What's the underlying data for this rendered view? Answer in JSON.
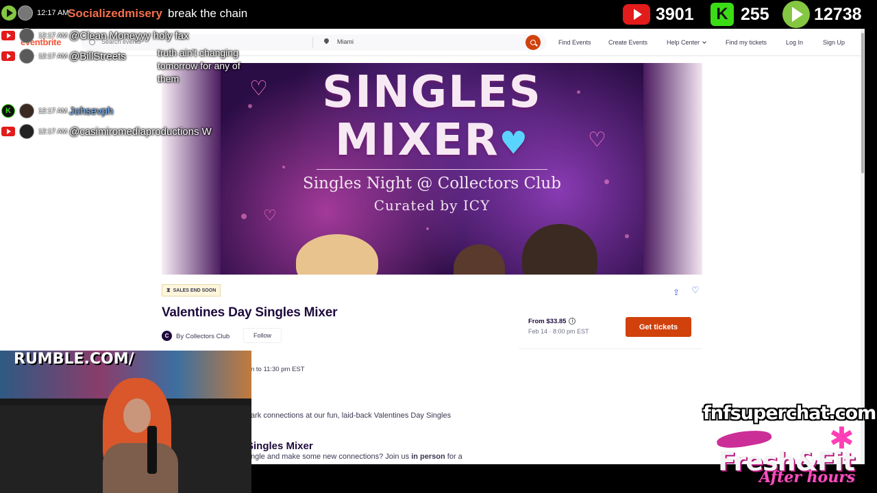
{
  "stream_bar": {
    "time": "12:17 AM",
    "username": "Socializedmisery",
    "message": "break the chain",
    "youtube_viewers": "3901",
    "kick_viewers": "255",
    "rumble_viewers": "12738"
  },
  "chat": [
    {
      "platform": "youtube",
      "time": "12:17 AM",
      "user": "@Clean.Moneyyy",
      "message": "holy fax"
    },
    {
      "platform": "youtube",
      "time": "12:17 AM",
      "user": "@BillStreets",
      "message": "truth ain't changing tomorrow for any of them"
    },
    {
      "platform": "kick",
      "time": "12:17 AM",
      "user": "Johsevph",
      "message": ""
    },
    {
      "platform": "youtube",
      "time": "12:17 AM",
      "user": "@casimiromediaproductions",
      "message": "W"
    }
  ],
  "navbar": {
    "logo": "eventbrite",
    "search_placeholder": "Search events",
    "location": "Miami",
    "links": [
      "Find Events",
      "Create Events",
      "Help Center",
      "Find my tickets",
      "Log In",
      "Sign Up"
    ]
  },
  "hero": {
    "title_line1": "SINGLES",
    "title_line2": "MIXER",
    "subtitle1": "Singles Night @ Collectors Club",
    "subtitle2": "Curated by ICY"
  },
  "event": {
    "badge": "SALES END SOON",
    "title": "Valentines Day Singles Mixer",
    "organizer_initial": "C",
    "organizer": "By Collectors Club",
    "follow_label": "Follow",
    "price": "From $33.85",
    "date": "Feb 14 · 8:00 pm EST",
    "cta": "Get tickets",
    "time_text": "n to 11:30 pm EST",
    "summary": "ark connections at our fun, laid-back Valentines Day Singles",
    "section_heading": "Singles Mixer",
    "body_prefix": "ngle and make some new connections? Join us ",
    "body_bold": "in person",
    "body_suffix": " for a"
  },
  "webcam": {
    "sign_text": "RUMBLE.COM/"
  },
  "branding": {
    "superchat": "fnfsuperchat.com",
    "fresh_fit": "Fresh&Fit",
    "after_hours": "After hours"
  },
  "colors": {
    "eventbrite_orange": "#d1410c",
    "youtube_red": "#e21b1b",
    "kick_green": "#3bdc16",
    "rumble_green": "#85c742",
    "superchat_user": "#f66f4c"
  }
}
